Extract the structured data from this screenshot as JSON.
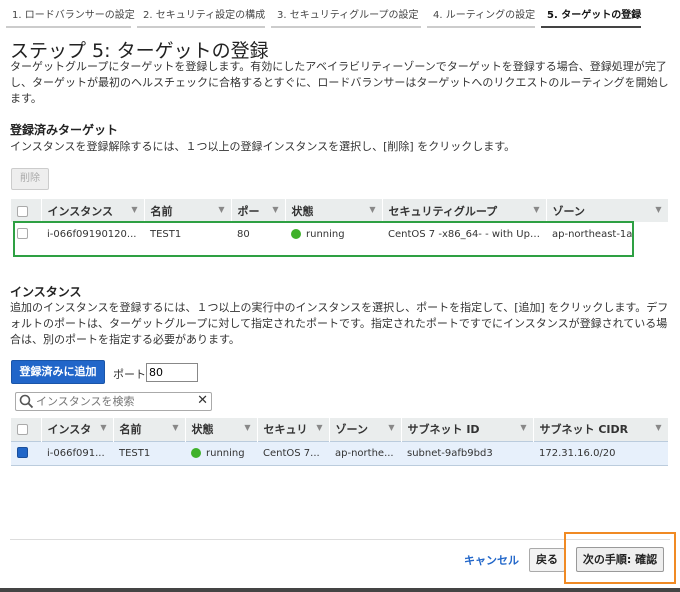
{
  "steps": [
    {
      "label": "1. ロードバランサーの設定"
    },
    {
      "label": "2. セキュリティ設定の構成"
    },
    {
      "label": "3. セキュリティグループの設定"
    },
    {
      "label": "4. ルーティングの設定"
    },
    {
      "label": "5. ターゲットの登録"
    }
  ],
  "page": {
    "title": "ステップ 5: ターゲットの登録",
    "description": "ターゲットグループにターゲットを登録します。有効にしたアベイラビリティーゾーンでターゲットを登録する場合、登録処理が完了し、ターゲットが最初のヘルスチェックに合格するとすぐに、ロードバランサーはターゲットへのリクエストのルーティングを開始します。"
  },
  "registered": {
    "heading": "登録済みターゲット",
    "instructions": "インスタンスを登録解除するには、１つ以上の登録インスタンスを選択し、[削除] をクリックします。",
    "remove_label": "削除",
    "columns": [
      "インスタンス",
      "名前",
      "ポー",
      "状態",
      "セキュリティグループ",
      "ゾーン"
    ],
    "rows": [
      {
        "instance": "i-066f09190120...",
        "name": "TEST1",
        "port": "80",
        "state": "running",
        "sg": "CentOS 7 -x86_64- - with Upd...",
        "zone": "ap-northeast-1a"
      }
    ]
  },
  "instances": {
    "heading": "インスタンス",
    "instructions": "追加のインスタンスを登録するには、１つ以上の実行中のインスタンスを選択し、ポートを指定して、[追加] をクリックします。デフォルトのポートは、ターゲットグループに対して指定されたポートです。指定されたポートですでにインスタンスが登録されている場合は、別のポートを指定する必要があります。",
    "add_label": "登録済みに追加",
    "port_label": "ポート",
    "port_value": "80",
    "search_placeholder": "インスタンスを検索",
    "columns": [
      "インスタ",
      "名前",
      "状態",
      "セキュリ",
      "ゾーン",
      "サブネット ID",
      "サブネット CIDR"
    ],
    "rows": [
      {
        "instance": "i-066f091...",
        "name": "TEST1",
        "state": "running",
        "sg": "CentOS 7...",
        "zone": "ap-northe...",
        "subnet_id": "subnet-9afb9bd3",
        "cidr": "172.31.16.0/20",
        "selected": true
      }
    ]
  },
  "footer": {
    "cancel_label": "キャンセル",
    "back_label": "戻る",
    "next_label": "次の手順: 確認"
  },
  "colors": {
    "primary": "#2166c9",
    "running": "#3fb12a",
    "highlight_green": "#2ea043",
    "highlight_orange": "#f08a24"
  }
}
